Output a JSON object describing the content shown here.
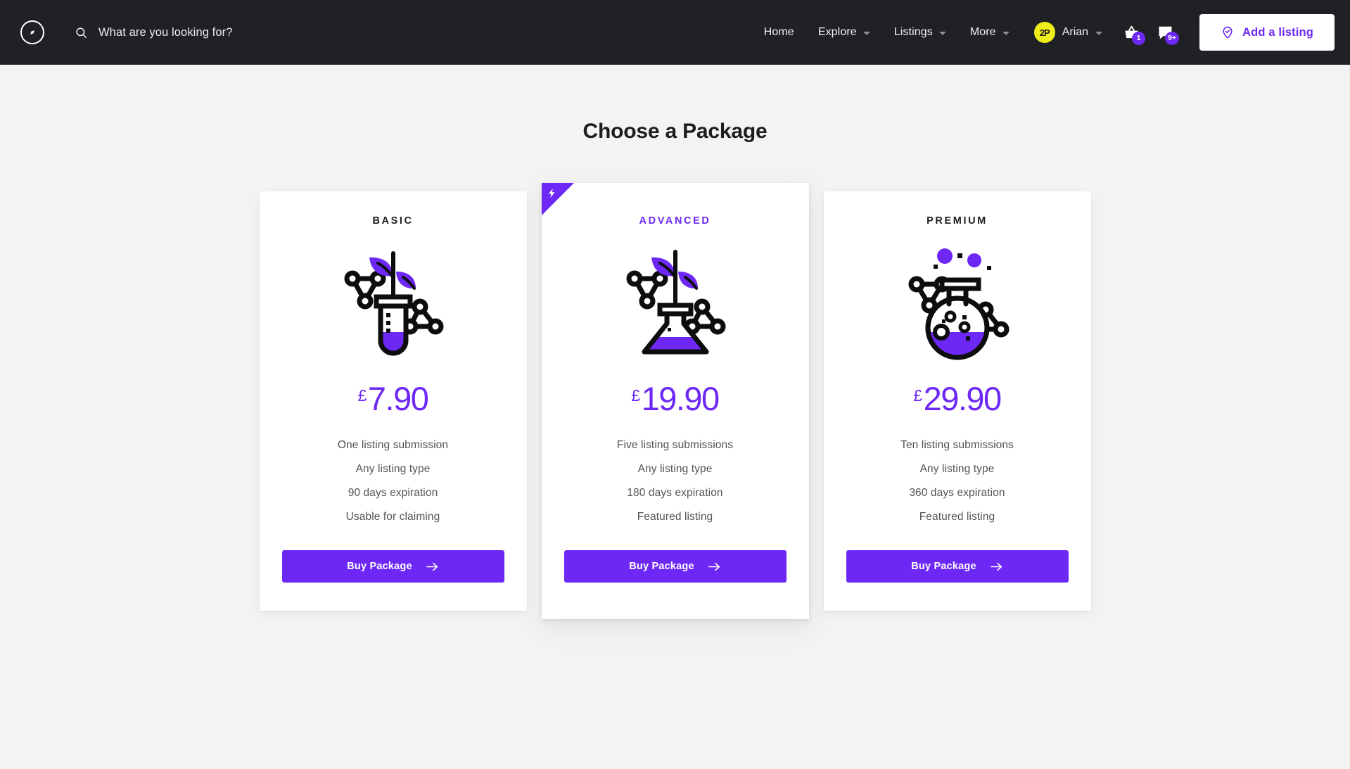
{
  "colors": {
    "accent": "#6d28f5",
    "navbar_bg": "#202124",
    "page_bg": "#f3f3f4",
    "card_bg": "#ffffff",
    "avatar_bg": "#efee1d",
    "badge_bg": "#6d28f5",
    "illustration_dark": "#0d0d0d",
    "illustration_purple": "#6d28f5"
  },
  "navbar": {
    "logo_icon": "compass-icon",
    "search": {
      "icon": "search-icon",
      "placeholder": "What are you looking for?",
      "value": ""
    },
    "links": [
      {
        "label": "Home",
        "has_dropdown": false
      },
      {
        "label": "Explore",
        "has_dropdown": true
      },
      {
        "label": "Listings",
        "has_dropdown": true
      },
      {
        "label": "More",
        "has_dropdown": true
      }
    ],
    "user": {
      "avatar_initials": "2P",
      "name": "Arian",
      "has_dropdown": true
    },
    "icons": [
      {
        "name": "basket-icon",
        "badge": "1"
      },
      {
        "name": "messages-icon",
        "badge": "9+"
      }
    ],
    "cta": {
      "icon": "map-pin-check-icon",
      "label": "Add a listing"
    }
  },
  "main": {
    "title": "Choose a Package",
    "packages": [
      {
        "title": "BASIC",
        "featured": false,
        "illustration": "test-tube-plant-icon",
        "currency": "£",
        "amount": "7.90",
        "features": [
          "One listing submission",
          "Any listing type",
          "90 days expiration",
          "Usable for claiming"
        ],
        "button_label": "Buy Package",
        "button_icon": "arrow-right-icon"
      },
      {
        "title": "ADVANCED",
        "featured": true,
        "ribbon_icon": "lightning-bolt-icon",
        "illustration": "erlenmeyer-flask-plant-icon",
        "currency": "£",
        "amount": "19.90",
        "features": [
          "Five listing submissions",
          "Any listing type",
          "180 days expiration",
          "Featured listing"
        ],
        "button_label": "Buy Package",
        "button_icon": "arrow-right-icon"
      },
      {
        "title": "PREMIUM",
        "featured": false,
        "illustration": "round-flask-bubbles-icon",
        "currency": "£",
        "amount": "29.90",
        "features": [
          "Ten listing submissions",
          "Any listing type",
          "360 days expiration",
          "Featured listing"
        ],
        "button_label": "Buy Package",
        "button_icon": "arrow-right-icon"
      }
    ]
  }
}
